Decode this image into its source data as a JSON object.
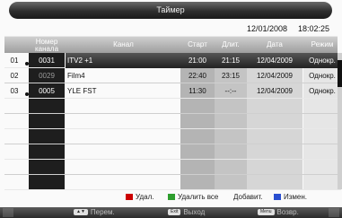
{
  "title": "Таймер",
  "datetime": {
    "date": "12/01/2008",
    "time": "18:02:25"
  },
  "columns": {
    "number": "Номер канала",
    "channel": "Канал",
    "start": "Старт",
    "end": "Длит.",
    "date": "Дата",
    "mode": "Режим"
  },
  "rows": [
    {
      "idx": "01",
      "number": "0031",
      "channel": "ITV2 +1",
      "start": "21:00",
      "end": "21:15",
      "date": "12/04/2009",
      "mode": "Однокр.",
      "selected": true
    },
    {
      "idx": "02",
      "number": "0029",
      "channel": "Film4",
      "start": "22:40",
      "end": "23:15",
      "date": "12/04/2009",
      "mode": "Однокр.",
      "selected": false
    },
    {
      "idx": "03",
      "number": "0005",
      "channel": "YLE FST",
      "start": "11:30",
      "end": "--:--",
      "date": "12/04/2009",
      "mode": "Однокр.",
      "selected": false
    }
  ],
  "empty_rows": 6,
  "legend": {
    "delete": "Удал.",
    "delete_all": "Удалить все",
    "add": "Добавит.",
    "edit": "Измен."
  },
  "nav": {
    "move": "Перем.",
    "exit": "Выход",
    "back": "Возвр.",
    "exit_key": "Exit",
    "menu_key": "Menu"
  },
  "colors": {
    "red": "#cc0000",
    "green": "#2e9e2e",
    "yellow": "#d8c600",
    "blue": "#2a4fd0"
  }
}
